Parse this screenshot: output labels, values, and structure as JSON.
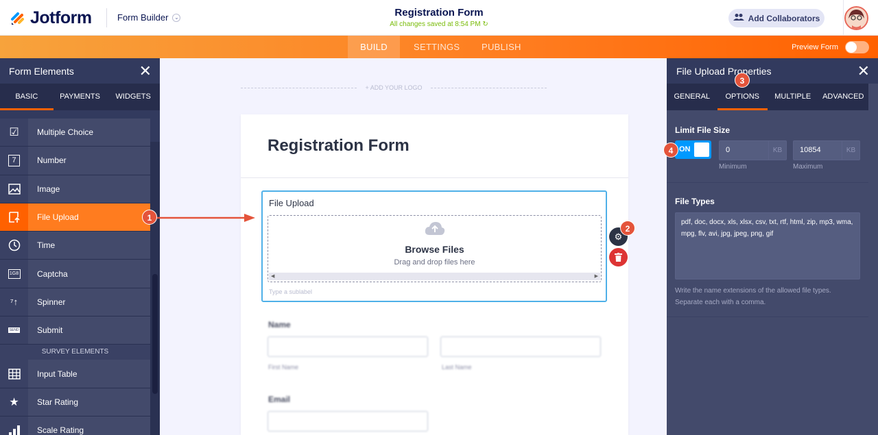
{
  "brand": {
    "name": "Jotform"
  },
  "topbar": {
    "builder_label": "Form Builder",
    "form_title": "Registration Form",
    "saved_status": "All changes saved at 8:54 PM",
    "collaborators_label": "Add Collaborators"
  },
  "nav": {
    "tabs": [
      {
        "label": "BUILD"
      },
      {
        "label": "SETTINGS"
      },
      {
        "label": "PUBLISH"
      }
    ],
    "preview_label": "Preview Form"
  },
  "left_panel": {
    "title": "Form Elements",
    "tabs": [
      {
        "label": "BASIC"
      },
      {
        "label": "PAYMENTS"
      },
      {
        "label": "WIDGETS"
      }
    ],
    "items": [
      {
        "label": "Multiple Choice",
        "icon": "checkbox-icon"
      },
      {
        "label": "Number",
        "icon": "number-icon"
      },
      {
        "label": "Image",
        "icon": "image-icon"
      },
      {
        "label": "File Upload",
        "icon": "file-upload-icon"
      },
      {
        "label": "Time",
        "icon": "clock-icon"
      },
      {
        "label": "Captcha",
        "icon": "captcha-icon"
      },
      {
        "label": "Spinner",
        "icon": "spinner-icon"
      },
      {
        "label": "Submit",
        "icon": "submit-icon"
      }
    ],
    "section_label": "SURVEY ELEMENTS",
    "survey_items": [
      {
        "label": "Input Table",
        "icon": "table-icon"
      },
      {
        "label": "Star Rating",
        "icon": "star-icon"
      },
      {
        "label": "Scale Rating",
        "icon": "bar-chart-icon"
      }
    ]
  },
  "canvas": {
    "add_logo": "+ ADD YOUR LOGO",
    "form_heading": "Registration Form",
    "upload": {
      "label": "File Upload",
      "browse": "Browse Files",
      "drag_text": "Drag and drop files here",
      "sublabel": "Type a sublabel"
    },
    "name_label": "Name",
    "first_name": "First Name",
    "last_name": "Last Name",
    "email_label": "Email"
  },
  "right_panel": {
    "title": "File Upload Properties",
    "tabs": [
      {
        "label": "GENERAL"
      },
      {
        "label": "OPTIONS"
      },
      {
        "label": "MULTIPLE"
      },
      {
        "label": "ADVANCED"
      }
    ],
    "limit_heading": "Limit File Size",
    "toggle_label": "ON",
    "min_value": "0",
    "max_value": "10854",
    "unit": "KB",
    "min_caption": "Minimum",
    "max_caption": "Maximum",
    "types_heading": "File Types",
    "types_value": "pdf, doc, docx, xls, xlsx, csv, txt, rtf, html, zip, mp3, wma, mpg, flv, avi, jpg, jpeg, png, gif",
    "help_text": "Write the name extensions of the allowed file types. Separate each with a comma."
  },
  "callouts": [
    "1",
    "2",
    "3",
    "4"
  ],
  "colors": {
    "accent": "#ff6100",
    "panel": "#434a6b",
    "dark": "#323a5e",
    "selected_border": "#4fb0e8",
    "badge": "#e4543b"
  }
}
